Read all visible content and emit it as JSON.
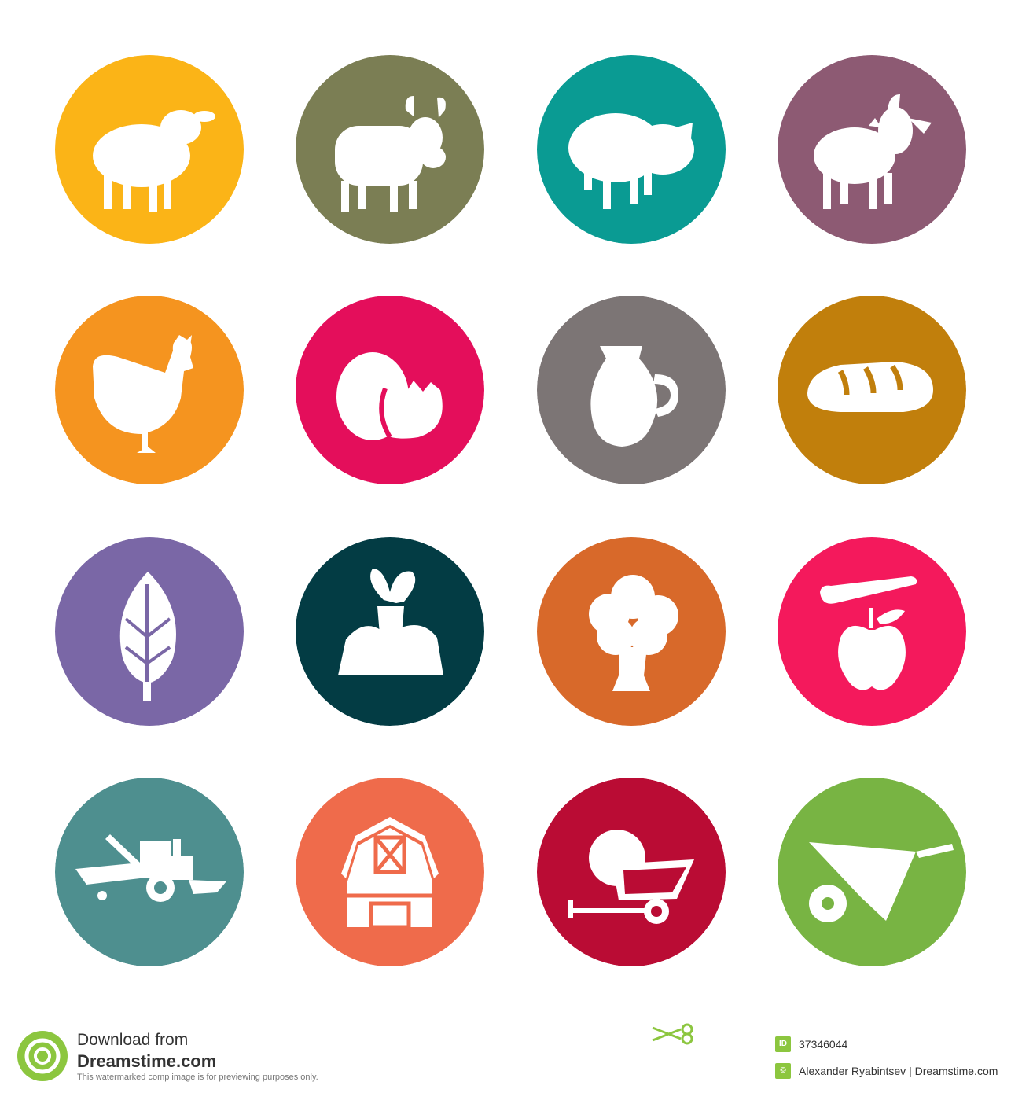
{
  "icons": [
    {
      "name": "sheep-icon",
      "color": "#fbb417"
    },
    {
      "name": "cow-icon",
      "color": "#7b7e54"
    },
    {
      "name": "pig-icon",
      "color": "#0a9b93"
    },
    {
      "name": "goat-icon",
      "color": "#8d5a73"
    },
    {
      "name": "chicken-icon",
      "color": "#f5941f"
    },
    {
      "name": "eggs-icon",
      "color": "#e40e5b"
    },
    {
      "name": "milk-jug-icon",
      "color": "#7c7575"
    },
    {
      "name": "bread-icon",
      "color": "#c17f0c"
    },
    {
      "name": "wheat-icon",
      "color": "#7a67a6"
    },
    {
      "name": "carrot-soil-icon",
      "color": "#033c44"
    },
    {
      "name": "broccoli-icon",
      "color": "#d8692a"
    },
    {
      "name": "apple-icon",
      "color": "#f4195c"
    },
    {
      "name": "combine-harvester-icon",
      "color": "#4e8f8f"
    },
    {
      "name": "barn-icon",
      "color": "#ef6b4b"
    },
    {
      "name": "hay-bale-trailer-icon",
      "color": "#ba0c34"
    },
    {
      "name": "wheelbarrow-icon",
      "color": "#78b443"
    }
  ],
  "footer": {
    "line1": "Download from",
    "line2": "Dreamstime.com",
    "line3": "This watermarked comp image is for previewing purposes only.",
    "id_badge": "ID",
    "image_id": "37346044",
    "copyright_badge": "©",
    "author": "Alexander Ryabintsev | Dreamstime.com"
  }
}
